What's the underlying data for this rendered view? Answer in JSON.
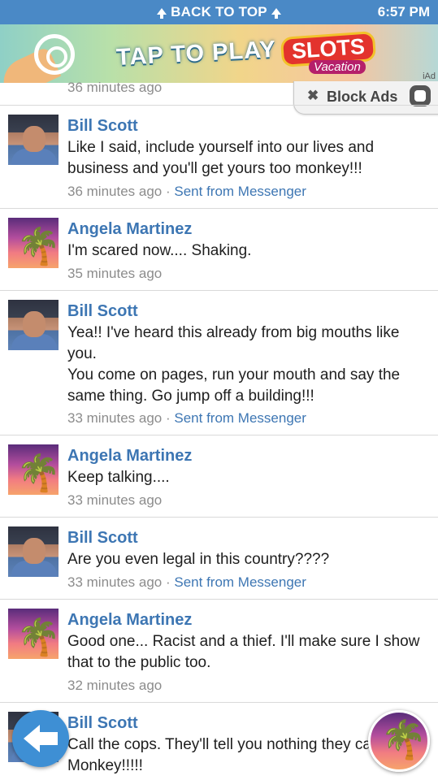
{
  "statusbar": {
    "back_to_top": "BACK TO TOP",
    "time": "6:57 PM"
  },
  "ad": {
    "tagline": "TAP TO PLAY",
    "brand": "SLOTS",
    "brand_sub": "Vacation",
    "iad_label": "iAd"
  },
  "block_ads": {
    "label": "Block Ads"
  },
  "top_meta": "36 minutes ago",
  "messages": [
    {
      "author": "Bill Scott",
      "text": "Like I said, include yourself into our lives and business and you'll get yours too monkey!!!",
      "time": "36 minutes ago",
      "sep": "·",
      "sent": "Sent from Messenger"
    },
    {
      "author": "Angela Martinez",
      "text": "I'm scared now.... Shaking.",
      "time": "35 minutes ago"
    },
    {
      "author": "Bill Scott",
      "text": "Yea!! I've heard this already from big mouths like you.\nYou come on pages, run your mouth and say the same thing. Go jump off a building!!!",
      "time": "33 minutes ago",
      "sep": "·",
      "sent": "Sent from Messenger"
    },
    {
      "author": "Angela Martinez",
      "text": "Keep talking....",
      "time": "33 minutes ago"
    },
    {
      "author": "Bill Scott",
      "text": "Are you even legal in this country????",
      "time": "33 minutes ago",
      "sep": "·",
      "sent": "Sent from Messenger"
    },
    {
      "author": "Angela Martinez",
      "text": "Good one... Racist and a thief. I'll make sure I show that to the public too.",
      "time": "32 minutes ago"
    },
    {
      "author": "Bill Scott",
      "text": "Call the cops. They'll tell you nothing they can do. Monkey!!!!!"
    }
  ],
  "colors": {
    "statusbar": "#4a89c6",
    "link_blue": "#3d76b3",
    "meta_gray": "#8c8c8c",
    "back_button": "#3e8fd4"
  },
  "icons": {
    "back": "back-arrow-icon",
    "chathead": "chat-head-avatar",
    "block": "block-ads-icon"
  }
}
